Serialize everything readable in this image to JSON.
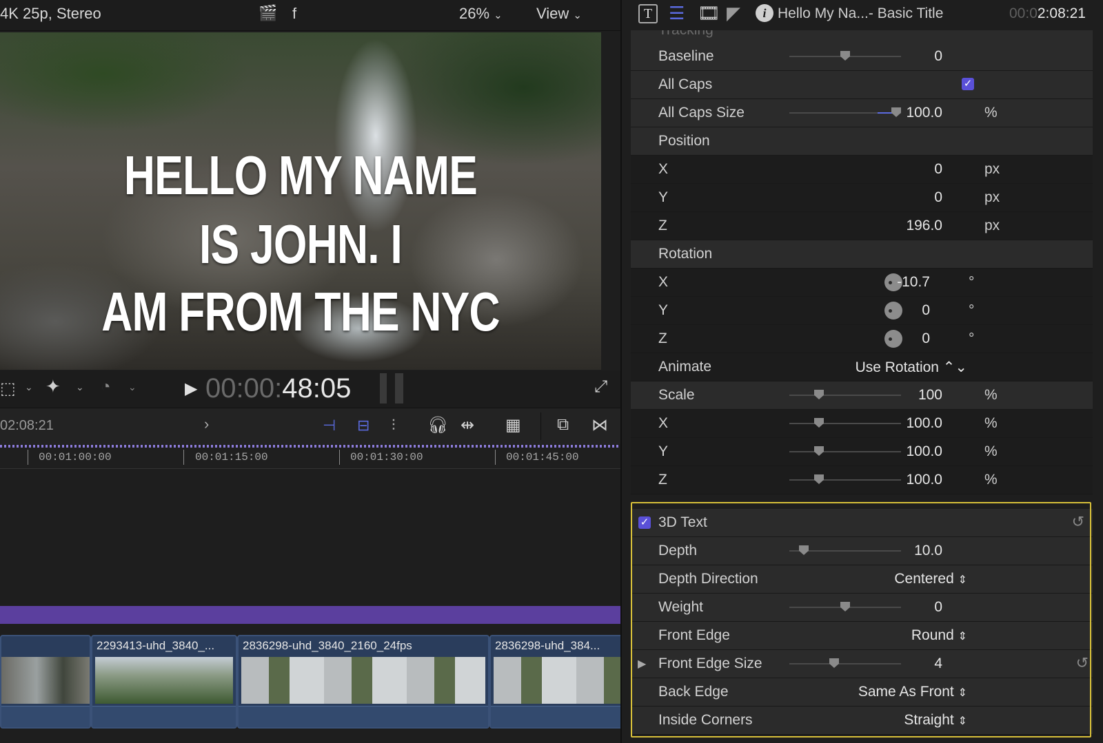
{
  "viewer": {
    "format": "4K 25p, Stereo",
    "zoom": "26%",
    "view_menu": "View",
    "f_label": "f",
    "headline_lines": [
      "HELLO MY NAME",
      "IS JOHN. I",
      "AM FROM THE NYC"
    ],
    "timecode_dim": "00:00:",
    "timecode": "48:05"
  },
  "timeline": {
    "duration": "02:08:21",
    "ruler_labels": [
      "00:01:00:00",
      "00:01:15:00",
      "00:01:30:00",
      "00:01:45:00"
    ],
    "clips": [
      "2293413-uhd_3840_...",
      "2836298-uhd_3840_2160_24fps",
      "2836298-uhd_384..."
    ]
  },
  "inspector": {
    "title": "Hello My Na...- Basic Title",
    "timecode_dim": "00:0",
    "timecode": "2:08:21",
    "tabs": [
      "text-tab-icon",
      "paragraph-tab-icon",
      "video-tab-icon",
      "generator-tab-icon",
      "info-tab-icon"
    ],
    "rows": {
      "tracking_partial": "Tracking",
      "baseline": {
        "label": "Baseline",
        "value": "0"
      },
      "all_caps": {
        "label": "All Caps"
      },
      "all_caps_size": {
        "label": "All Caps Size",
        "value": "100.0",
        "unit": "%"
      },
      "position": {
        "label": "Position"
      },
      "pos_x": {
        "label": "X",
        "value": "0",
        "unit": "px"
      },
      "pos_y": {
        "label": "Y",
        "value": "0",
        "unit": "px"
      },
      "pos_z": {
        "label": "Z",
        "value": "196.0",
        "unit": "px"
      },
      "rotation": {
        "label": "Rotation"
      },
      "rot_x": {
        "label": "X",
        "value": "-10.7",
        "unit": "°"
      },
      "rot_y": {
        "label": "Y",
        "value": "0",
        "unit": "°"
      },
      "rot_z": {
        "label": "Z",
        "value": "0",
        "unit": "°"
      },
      "animate": {
        "label": "Animate",
        "value": "Use Rotation ⌃⌄"
      },
      "scale": {
        "label": "Scale",
        "value": "100",
        "unit": "%"
      },
      "scale_x": {
        "label": "X",
        "value": "100.0",
        "unit": "%"
      },
      "scale_y": {
        "label": "Y",
        "value": "100.0",
        "unit": "%"
      },
      "scale_z": {
        "label": "Z",
        "value": "100.0",
        "unit": "%"
      },
      "text3d": {
        "label": "3D Text"
      },
      "depth": {
        "label": "Depth",
        "value": "10.0"
      },
      "depth_direction": {
        "label": "Depth Direction",
        "value": "Centered"
      },
      "weight": {
        "label": "Weight",
        "value": "0"
      },
      "front_edge": {
        "label": "Front Edge",
        "value": "Round"
      },
      "front_edge_size": {
        "label": "Front Edge Size",
        "value": "4"
      },
      "back_edge": {
        "label": "Back Edge",
        "value": "Same As Front"
      },
      "inside_corners": {
        "label": "Inside Corners",
        "value": "Straight"
      }
    }
  },
  "colors": {
    "accent": "#5a50d8",
    "highlight": "#d8c03a",
    "title_clip": "#5b3f9e",
    "clip": "#2a3d5c"
  }
}
